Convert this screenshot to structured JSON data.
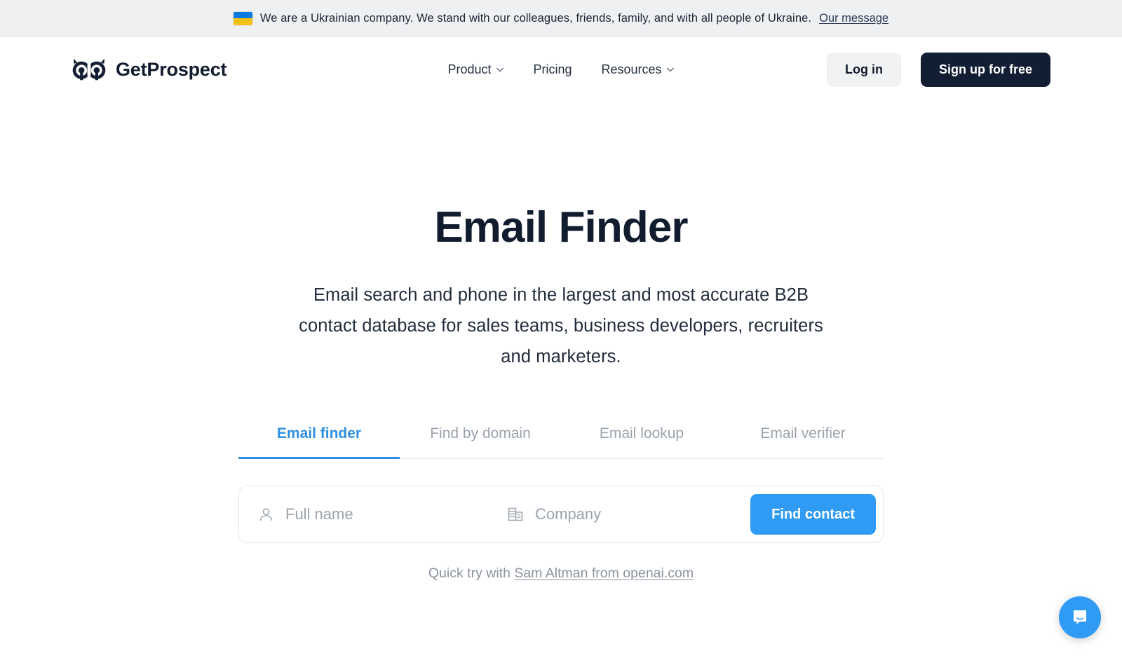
{
  "banner": {
    "flag_icon": "ukraine-flag-icon",
    "text": "We are a Ukrainian company. We stand with our colleagues, friends, family, and with all people of Ukraine.",
    "link_label": "Our message"
  },
  "header": {
    "logo_icon": "owl-logo-icon",
    "logo_text": "GetProspect",
    "nav": [
      {
        "label": "Product",
        "has_chevron": true,
        "icon": "chevron-down-icon"
      },
      {
        "label": "Pricing",
        "has_chevron": false,
        "icon": ""
      },
      {
        "label": "Resources",
        "has_chevron": true,
        "icon": "chevron-down-icon"
      }
    ],
    "login_label": "Log in",
    "signup_label": "Sign up for free"
  },
  "hero": {
    "title": "Email Finder",
    "subtitle": "Email search and phone in the largest and most accurate B2B contact database for sales teams, business developers, recruiters and marketers."
  },
  "tabs": [
    {
      "label": "Email finder",
      "active": true
    },
    {
      "label": "Find by domain",
      "active": false
    },
    {
      "label": "Email lookup",
      "active": false
    },
    {
      "label": "Email verifier",
      "active": false
    }
  ],
  "search": {
    "name_icon": "person-icon",
    "name_placeholder": "Full name",
    "name_value": "",
    "company_icon": "building-icon",
    "company_placeholder": "Company",
    "company_value": "",
    "submit_label": "Find contact"
  },
  "quick_try": {
    "prefix": "Quick try with ",
    "link_label": "Sam Altman from openai.com"
  },
  "chat": {
    "icon": "chat-bubble-icon"
  },
  "colors": {
    "accent_blue": "#2f9bf5",
    "tab_blue": "#2f8fe0",
    "dark_navy": "#121e33",
    "banner_bg": "#eef0f2",
    "muted_text": "#9aa3ad"
  }
}
